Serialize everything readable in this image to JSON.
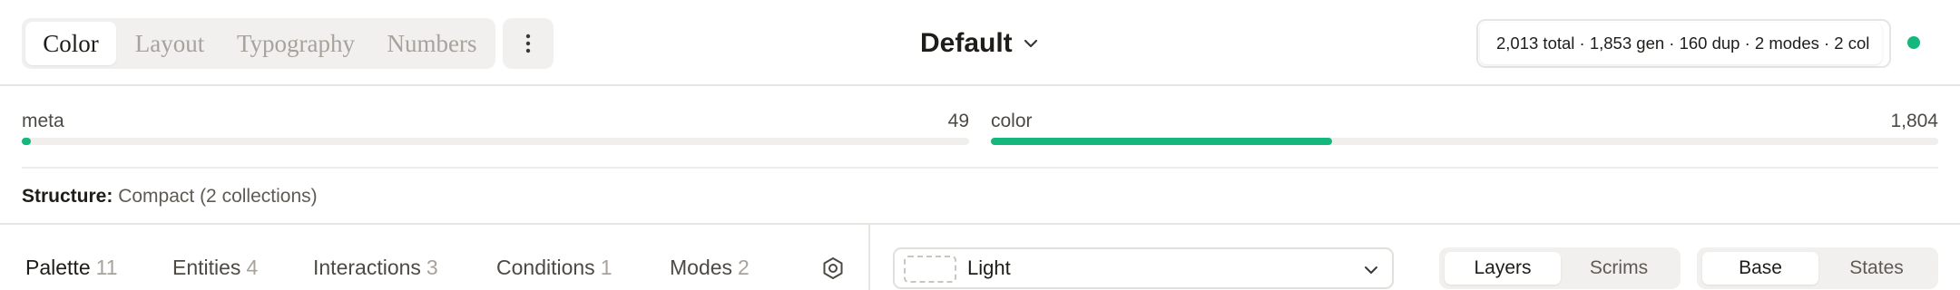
{
  "header": {
    "tabs": [
      {
        "label": "Color",
        "active": true
      },
      {
        "label": "Layout",
        "active": false
      },
      {
        "label": "Typography",
        "active": false
      },
      {
        "label": "Numbers",
        "active": false
      }
    ],
    "more_icon": "vertical-dots-icon",
    "preset": {
      "label": "Default",
      "icon": "chevron-down-icon"
    },
    "stats": "2,013 total · 1,853 gen · 160 dup · 2 modes · 2 col",
    "status_color": "#14b87c"
  },
  "collections": [
    {
      "name": "meta",
      "count": "49",
      "fill_fraction": 0.01
    },
    {
      "name": "color",
      "count": "1,804",
      "fill_fraction": 0.36
    }
  ],
  "accent_color": "#14b87c",
  "structure": {
    "label": "Structure:",
    "value": "Compact (2 collections)"
  },
  "bottom": {
    "tabs": [
      {
        "label": "Palette",
        "count": "11",
        "active": true
      },
      {
        "label": "Entities",
        "count": "4",
        "active": false
      },
      {
        "label": "Interactions",
        "count": "3",
        "active": false
      },
      {
        "label": "Conditions",
        "count": "1",
        "active": false
      },
      {
        "label": "Modes",
        "count": "2",
        "active": false
      }
    ],
    "settings_icon": "hexagon-settings-icon",
    "mode_select": {
      "value": "Light",
      "icon": "chevron-down-icon"
    },
    "view_toggle": [
      {
        "label": "Layers",
        "active": true
      },
      {
        "label": "Scrims",
        "active": false
      }
    ],
    "state_toggle": [
      {
        "label": "Base",
        "active": true
      },
      {
        "label": "States",
        "active": false
      }
    ]
  }
}
